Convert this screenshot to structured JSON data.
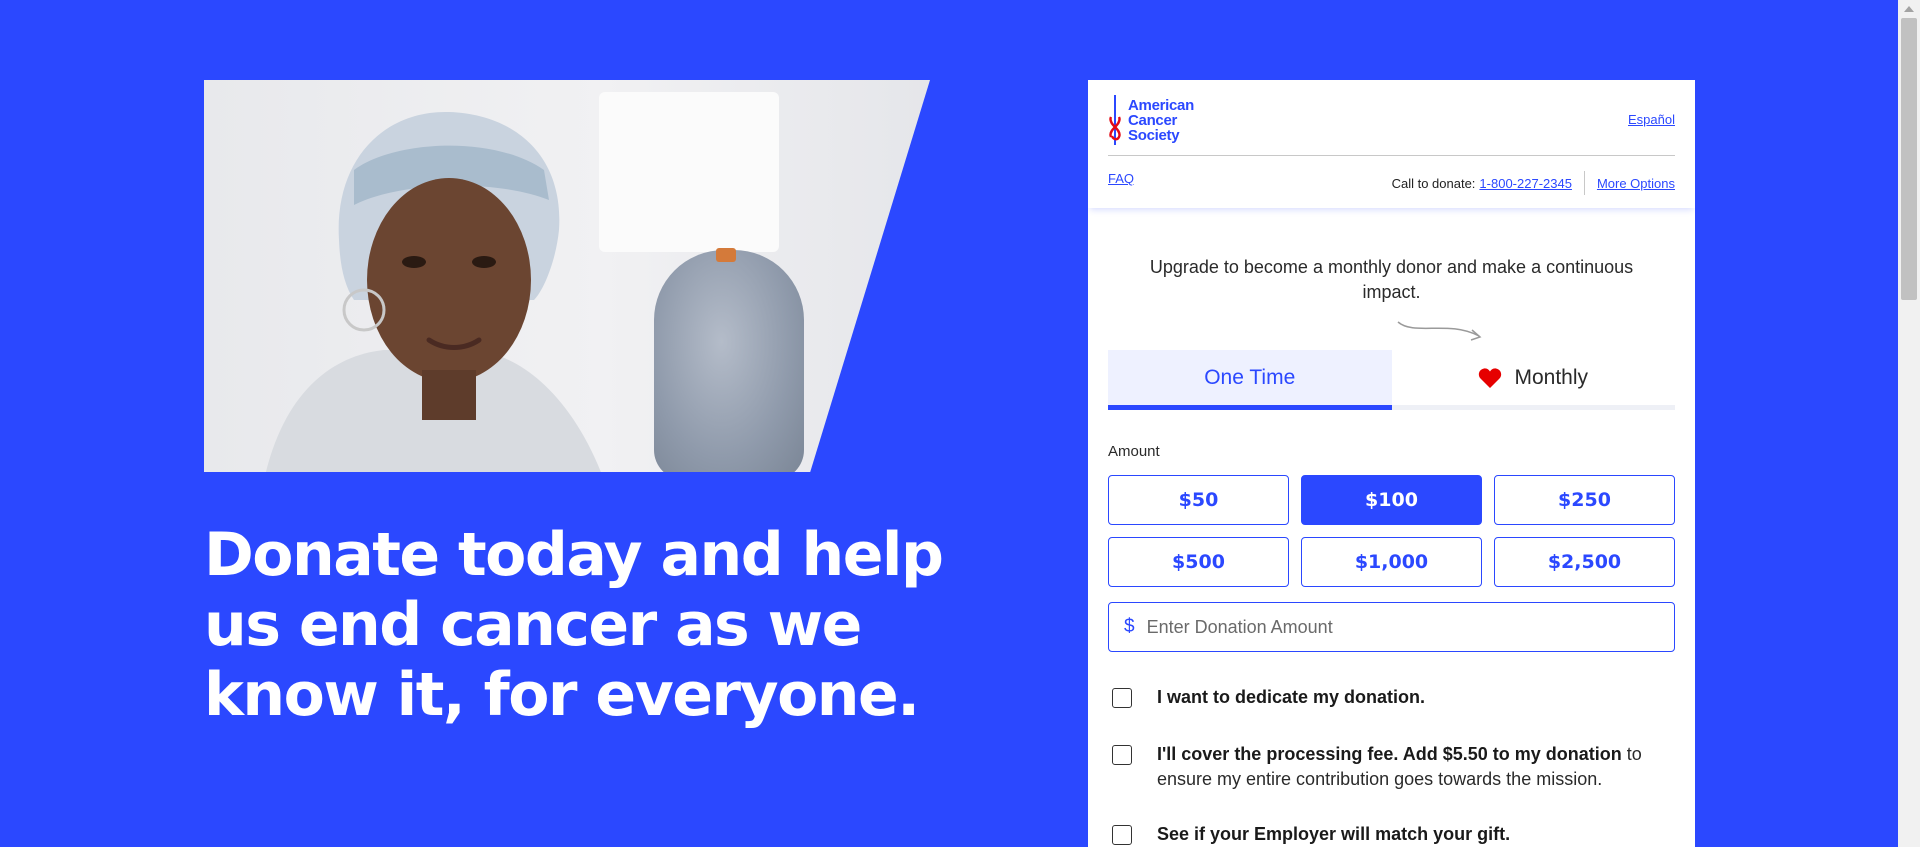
{
  "hero": {
    "headline": "Donate today and help us end cancer as we know it, for everyone.",
    "photo_alt": "Smiling woman wearing a head scarf"
  },
  "header": {
    "logo_lines": [
      "American",
      "Cancer",
      "Society"
    ],
    "language_link": "Español",
    "faq_link": "FAQ",
    "call_label": "Call to donate:",
    "phone": "1-800-227-2345",
    "more_options": "More Options"
  },
  "upgrade": {
    "text": "Upgrade to become a monthly donor and make a continuous impact."
  },
  "tabs": {
    "one_time": "One Time",
    "monthly": "Monthly",
    "selected": "One Time"
  },
  "amount": {
    "label": "Amount",
    "options": [
      "$50",
      "$100",
      "$250",
      "$500",
      "$1,000",
      "$2,500"
    ],
    "selected": "$100",
    "currency_symbol": "$",
    "custom_placeholder": "Enter Donation Amount",
    "custom_value": ""
  },
  "options": {
    "dedicate": "I want to dedicate my donation.",
    "fee_strong": "I'll cover the processing fee. Add $5.50 to my donation",
    "fee_rest": " to ensure my entire contribution goes towards the mission.",
    "employer": "See if your Employer will match your gift."
  },
  "colors": {
    "brand_blue": "#2b48ff",
    "heart_red": "#e60000",
    "logo_red": "#e30b17"
  }
}
